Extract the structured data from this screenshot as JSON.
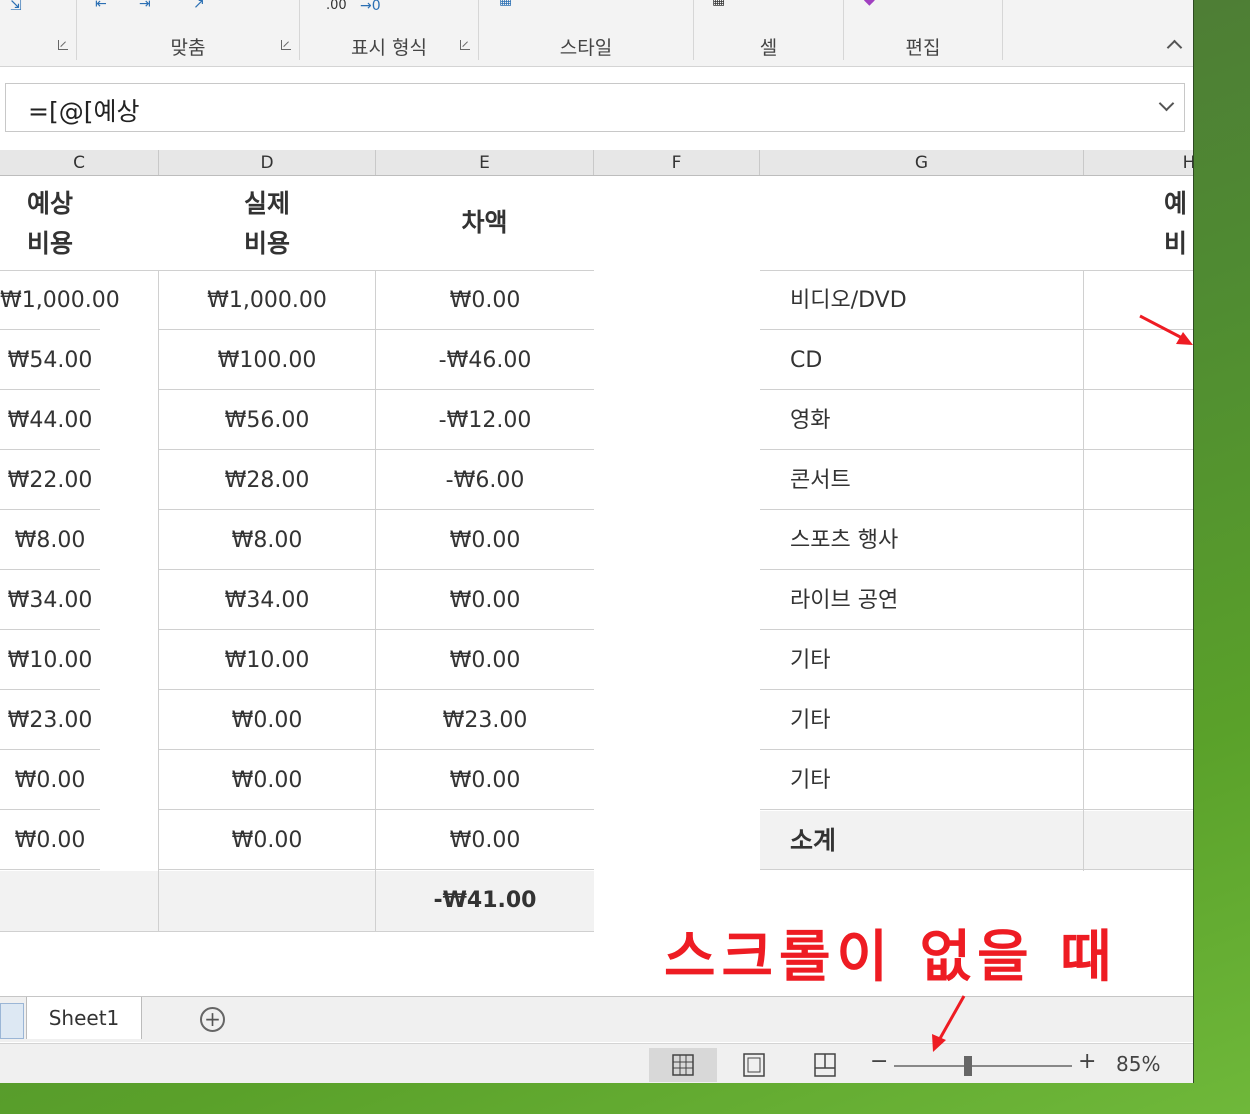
{
  "ribbon": {
    "groups": [
      {
        "label": "맞춤"
      },
      {
        "label": "표시 형식"
      },
      {
        "label": "스타일"
      },
      {
        "label": "셀"
      },
      {
        "label": "편집"
      }
    ]
  },
  "formula_bar": {
    "value": "=[@[예상"
  },
  "columns": [
    "C",
    "D",
    "E",
    "F",
    "G",
    "H"
  ],
  "table": {
    "headers": {
      "c": [
        "예상",
        "비용"
      ],
      "d": [
        "실제",
        "비용"
      ],
      "e": "차액",
      "h": [
        "예",
        "비"
      ]
    },
    "rows": [
      {
        "c": "₩1,000.00",
        "d": "₩1,000.00",
        "e": "₩0.00",
        "g": "비디오/DVD"
      },
      {
        "c": "₩54.00",
        "d": "₩100.00",
        "e": "-₩46.00",
        "g": "CD"
      },
      {
        "c": "₩44.00",
        "d": "₩56.00",
        "e": "-₩12.00",
        "g": "영화"
      },
      {
        "c": "₩22.00",
        "d": "₩28.00",
        "e": "-₩6.00",
        "g": "콘서트"
      },
      {
        "c": "₩8.00",
        "d": "₩8.00",
        "e": "₩0.00",
        "g": "스포츠 행사"
      },
      {
        "c": "₩34.00",
        "d": "₩34.00",
        "e": "₩0.00",
        "g": "라이브 공연"
      },
      {
        "c": "₩10.00",
        "d": "₩10.00",
        "e": "₩0.00",
        "g": "기타"
      },
      {
        "c": "₩23.00",
        "d": "₩0.00",
        "e": "₩23.00",
        "g": "기타"
      },
      {
        "c": "₩0.00",
        "d": "₩0.00",
        "e": "₩0.00",
        "g": "기타"
      },
      {
        "c": "₩0.00",
        "d": "₩0.00",
        "e": "₩0.00",
        "g": "소계"
      }
    ],
    "total": {
      "e": "-₩41.00"
    }
  },
  "sheet_tabs": [
    {
      "label": "Sheet1"
    }
  ],
  "status": {
    "zoom": "85%",
    "zoom_minus": "−",
    "zoom_plus": "+"
  },
  "annotation": {
    "text": "스크롤이 없을 때",
    "color": "#ee1c23"
  }
}
